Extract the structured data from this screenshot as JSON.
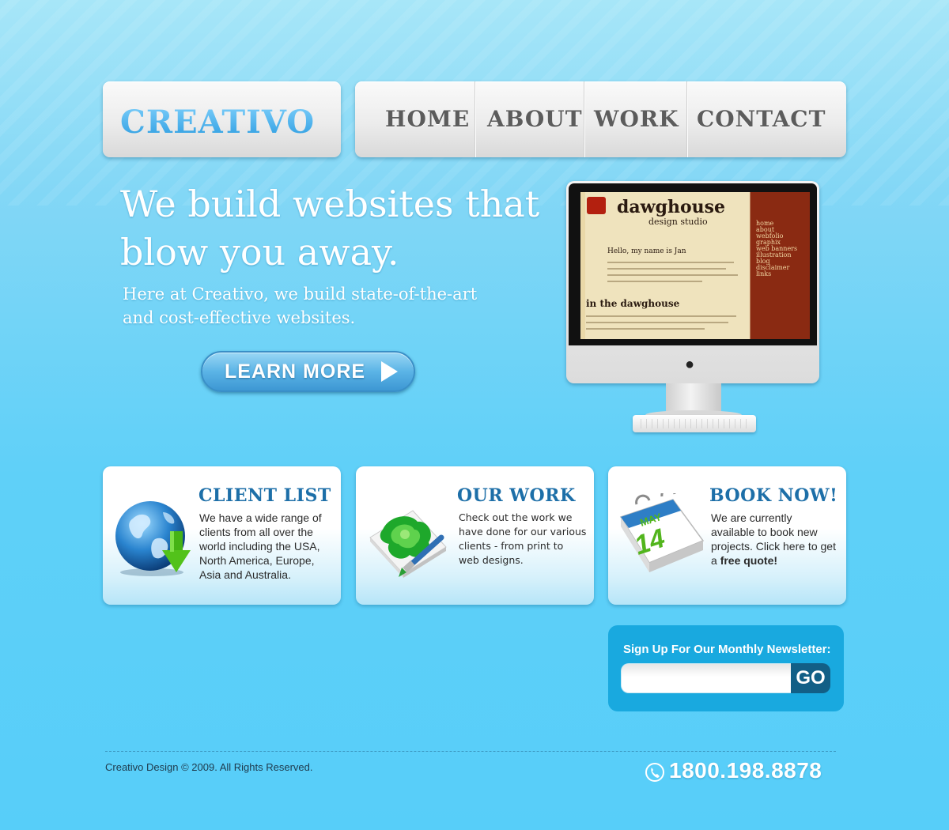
{
  "brand": {
    "logo": "CREATIVO"
  },
  "nav": {
    "items": [
      {
        "label": "HOME"
      },
      {
        "label": "ABOUT"
      },
      {
        "label": "WORK"
      },
      {
        "label": "CONTACT"
      }
    ]
  },
  "hero": {
    "headline_line1": "We build websites that",
    "headline_line2": "blow you away.",
    "sub_line1": "Here at Creativo, we build state-of-the-art",
    "sub_line2": "and cost-effective websites.",
    "cta_label": "LEARN MORE",
    "cta_icon": "play-arrow-icon"
  },
  "monitor_screen": {
    "brand": "dawghouse",
    "brand_sub": "design studio",
    "hello": "Hello, my name is Jan",
    "heading": "in the dawghouse",
    "menu": [
      "home",
      "about",
      "webfolio",
      "graphix",
      "web banners",
      "illustration",
      "blog",
      "disclaimer",
      "links"
    ]
  },
  "cards": [
    {
      "title": "CLIENT LIST",
      "text": "We have a wide range of clients from all over the world including the USA, North America, Europe, Asia and Australia.",
      "icon": "globe-download-icon"
    },
    {
      "title": "OUR WORK",
      "text": "Check out the work we have done for our various clients - from print to web designs.",
      "icon": "paint-brush-canvas-icon"
    },
    {
      "title": "BOOK NOW!",
      "text_prefix": "We are currently available to book new projects. Click here to get a ",
      "text_bold": "free quote!",
      "icon": "calendar-icon",
      "calendar_month": "MAY",
      "calendar_day": "14"
    }
  ],
  "newsletter": {
    "label": "Sign Up For Our Monthly Newsletter:",
    "input_value": "",
    "button": "GO"
  },
  "footer": {
    "copyright": "Creativo Design © 2009. All Rights Reserved.",
    "phone": "1800.198.8878",
    "phone_icon": "phone-icon"
  },
  "colors": {
    "background": "#5fd0f8",
    "accent_blue": "#1d6fa8",
    "logo_blue": "#3aa8e6",
    "newsletter_bg": "#19a9df",
    "go_button": "#125f86"
  }
}
